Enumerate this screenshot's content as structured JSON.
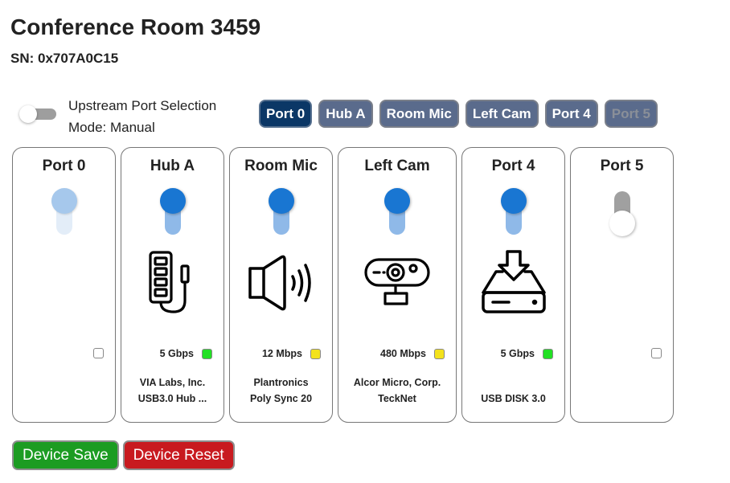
{
  "header": {
    "title": "Conference Room 3459",
    "serial": "SN: 0x707A0C15"
  },
  "upstream": {
    "label_line1": "Upstream Port Selection",
    "label_line2": "Mode: Manual",
    "auto_enabled": false
  },
  "port_buttons": [
    {
      "label": "Port 0",
      "state": "selected"
    },
    {
      "label": "Hub A",
      "state": "normal"
    },
    {
      "label": "Room Mic",
      "state": "normal"
    },
    {
      "label": "Left Cam",
      "state": "normal"
    },
    {
      "label": "Port 4",
      "state": "normal"
    },
    {
      "label": "Port 5",
      "state": "disabled"
    }
  ],
  "ports": [
    {
      "title": "Port 0",
      "toggle": "on-disabled",
      "icon": "none",
      "speed": "",
      "led": "off",
      "device_line1": "",
      "device_line2": ""
    },
    {
      "title": "Hub A",
      "toggle": "on",
      "icon": "usb-hub-icon",
      "speed": "5 Gbps",
      "led": "green",
      "device_line1": "VIA Labs, Inc.",
      "device_line2": "USB3.0 Hub ..."
    },
    {
      "title": "Room Mic",
      "toggle": "on",
      "icon": "speaker-icon",
      "speed": "12 Mbps",
      "led": "yellow",
      "device_line1": "Plantronics",
      "device_line2": "Poly Sync 20"
    },
    {
      "title": "Left Cam",
      "toggle": "on",
      "icon": "webcam-icon",
      "speed": "480 Mbps",
      "led": "yellow",
      "device_line1": "Alcor Micro, Corp.",
      "device_line2": "TeckNet"
    },
    {
      "title": "Port 4",
      "toggle": "on",
      "icon": "usb-disk-icon",
      "speed": "5 Gbps",
      "led": "green",
      "device_line1": "",
      "device_line2": "USB DISK 3.0"
    },
    {
      "title": "Port 5",
      "toggle": "off",
      "icon": "none",
      "speed": "",
      "led": "off",
      "device_line1": "",
      "device_line2": ""
    }
  ],
  "led_colors": {
    "green": "#22e024",
    "yellow": "#f3e21c",
    "off": "#ffffff"
  },
  "actions": {
    "save_label": "Device Save",
    "reset_label": "Device Reset"
  },
  "colors": {
    "button_selected": "#0b3766",
    "button_normal": "#5a6b8c",
    "toggle_on": "#1976d2",
    "save": "#1c9c22",
    "reset": "#c81a1f"
  }
}
